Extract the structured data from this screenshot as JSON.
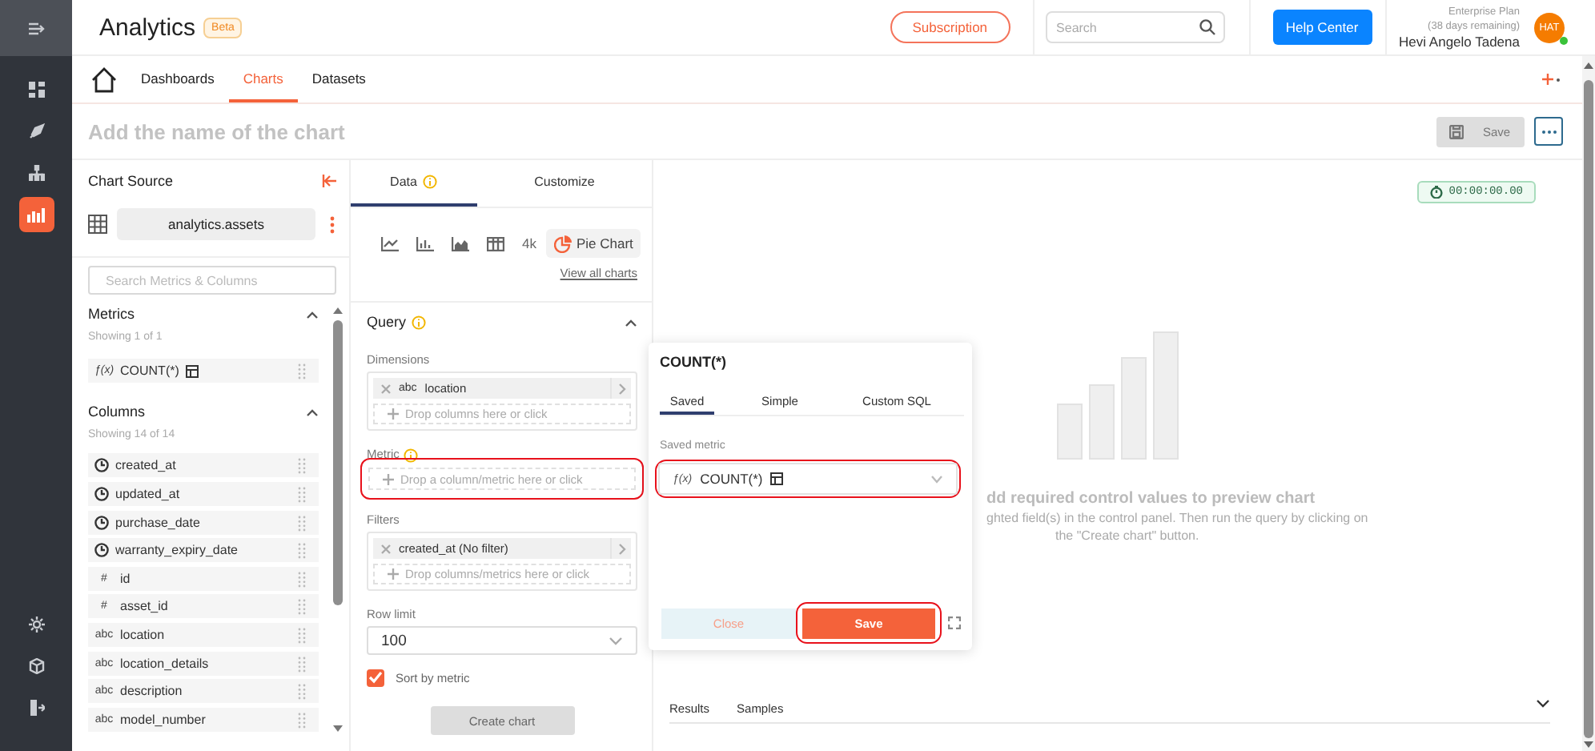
{
  "rail": {
    "items": [
      {
        "selected": false
      },
      {
        "selected": false
      },
      {
        "selected": false
      },
      {
        "selected": true
      }
    ]
  },
  "header": {
    "app_name": "Analytics",
    "badge": "Beta",
    "subscription": "Subscription",
    "search": {
      "placeholder": "Search"
    },
    "help": "Help Center",
    "plan": "Enterprise Plan",
    "plan_note": "(38 days remaining)",
    "user_name": "Hevi Angelo Tadena",
    "avatar": "HAT",
    "online": true
  },
  "nav_tabs": [
    {
      "label": "Dashboards",
      "selected": false
    },
    {
      "label": "Charts",
      "selected": true
    },
    {
      "label": "Datasets",
      "selected": false
    }
  ],
  "chart_name": {
    "placeholder": "Add the name of the chart"
  },
  "save_button": "Save",
  "source": {
    "title": "Chart Source",
    "dataset": "analytics.assets",
    "search": {
      "placeholder": "Search Metrics & Columns"
    },
    "metrics": {
      "title": "Metrics",
      "count": "Showing 1 of 1",
      "expanded": true,
      "items": [
        {
          "kind": "metric",
          "type_label": "ƒ(x)",
          "name": "COUNT(*)"
        }
      ]
    },
    "columns": {
      "title": "Columns",
      "count": "Showing 14 of 14",
      "expanded": true,
      "items": [
        {
          "kind": "time",
          "name": "created_at"
        },
        {
          "kind": "time",
          "name": "updated_at"
        },
        {
          "kind": "time",
          "name": "purchase_date"
        },
        {
          "kind": "time",
          "name": "warranty_expiry_date"
        },
        {
          "kind": "number",
          "type_label": "#",
          "name": "id"
        },
        {
          "kind": "number",
          "type_label": "#",
          "name": "asset_id"
        },
        {
          "kind": "string",
          "type_label": "abc",
          "name": "location"
        },
        {
          "kind": "string",
          "type_label": "abc",
          "name": "location_details"
        },
        {
          "kind": "string",
          "type_label": "abc",
          "name": "description"
        },
        {
          "kind": "string",
          "type_label": "abc",
          "name": "model_number"
        }
      ]
    }
  },
  "controls": {
    "tabs": [
      {
        "label": "Data",
        "selected": true,
        "info": true
      },
      {
        "label": "Customize",
        "selected": false,
        "info": false
      }
    ],
    "chart_types": [
      {
        "kind": "line",
        "selected": false
      },
      {
        "kind": "bar",
        "selected": false
      },
      {
        "kind": "area",
        "selected": false
      },
      {
        "kind": "table",
        "selected": false
      },
      {
        "kind": "text",
        "label": "4k",
        "selected": false
      },
      {
        "kind": "pie",
        "label": "Pie Chart",
        "selected": true
      }
    ],
    "view_all": "View all charts",
    "query": {
      "title": "Query",
      "expanded": true,
      "dimensions": {
        "label": "Dimensions",
        "chips": [
          {
            "type_label": "abc",
            "name": "location"
          }
        ],
        "drop_hint": "Drop columns here or click"
      },
      "metric": {
        "label": "Metric",
        "drop_hint": "Drop a column/metric here or click",
        "highlighted": true
      },
      "filters": {
        "label": "Filters",
        "chips": [
          {
            "name": "created_at (No filter)"
          }
        ],
        "drop_hint": "Drop columns/metrics here or click"
      },
      "row_limit": {
        "label": "Row limit",
        "value": "100"
      },
      "sort_by_metric": {
        "label": "Sort by metric",
        "checked": true
      }
    },
    "create_button": "Create chart"
  },
  "preview": {
    "timer": "00:00:00.00",
    "heading": "dd required control values to preview chart",
    "hint_lines": [
      "ghted field(s) in the control panel. Then run the query by clicking on",
      "the \"Create chart\" button."
    ],
    "tabs": [
      {
        "label": "Results",
        "selected": false
      },
      {
        "label": "Samples",
        "selected": false
      }
    ]
  },
  "popover": {
    "title": "COUNT(*)",
    "tabs": [
      {
        "label": "Saved",
        "selected": true
      },
      {
        "label": "Simple",
        "selected": false
      },
      {
        "label": "Custom SQL",
        "selected": false
      }
    ],
    "field_label": "Saved metric",
    "value": {
      "type_label": "ƒ(x)",
      "name": "COUNT(*)"
    },
    "highlighted": true,
    "close": "Close",
    "save": "Save",
    "save_highlighted": true
  }
}
